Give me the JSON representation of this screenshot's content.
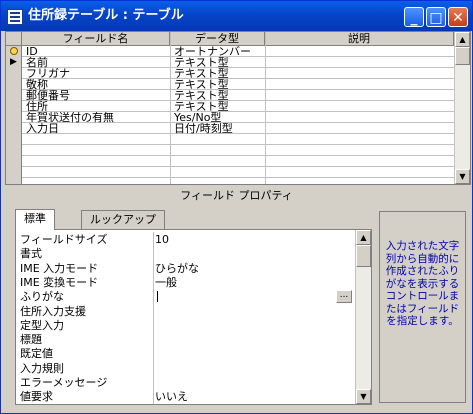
{
  "window": {
    "title": "住所録テーブル : テーブル"
  },
  "grid": {
    "headers": [
      "フィールド名",
      "データ型",
      "説明"
    ],
    "rows": [
      {
        "name": "ID",
        "type": "オートナンバー",
        "key": true
      },
      {
        "name": "名前",
        "type": "テキスト型",
        "current": true
      },
      {
        "name": "フリガナ",
        "type": "テキスト型"
      },
      {
        "name": "敬称",
        "type": "テキスト型"
      },
      {
        "name": "郵便番号",
        "type": "テキスト型"
      },
      {
        "name": "住所",
        "type": "テキスト型"
      },
      {
        "name": "年賀状送付の有無",
        "type": "Yes/No型"
      },
      {
        "name": "入力日",
        "type": "日付/時刻型"
      },
      {
        "name": "",
        "type": ""
      },
      {
        "name": "",
        "type": ""
      },
      {
        "name": "",
        "type": ""
      },
      {
        "name": "",
        "type": ""
      },
      {
        "name": "",
        "type": ""
      }
    ]
  },
  "properties": {
    "title": "フィールド プロパティ",
    "tabs": [
      "標準",
      "ルックアップ"
    ],
    "rows": [
      {
        "label": "フィールドサイズ",
        "value": "10"
      },
      {
        "label": "書式",
        "value": ""
      },
      {
        "label": "IME 入力モード",
        "value": "ひらがな"
      },
      {
        "label": "IME 変換モード",
        "value": "一般"
      },
      {
        "label": "ふりがな",
        "value": "",
        "editing": true
      },
      {
        "label": "住所入力支援",
        "value": ""
      },
      {
        "label": "定型入力",
        "value": ""
      },
      {
        "label": "標題",
        "value": ""
      },
      {
        "label": "既定値",
        "value": ""
      },
      {
        "label": "入力規則",
        "value": ""
      },
      {
        "label": "エラーメッセージ",
        "value": ""
      },
      {
        "label": "値要求",
        "value": "いいえ"
      }
    ],
    "help": "入力された文字列から自動的に作成されたふりがなを表示するコントロールまたはフィールドを指定します。"
  },
  "colors": {
    "titlebar": "#0a5fe8",
    "help_text": "#0000b0"
  },
  "icons": {
    "title": "table-icon",
    "minimize": "minimize-icon",
    "maximize": "maximize-icon",
    "close": "close-icon",
    "key": "primary-key-icon",
    "current": "row-pointer-icon",
    "builder": "builder-ellipsis-icon"
  }
}
